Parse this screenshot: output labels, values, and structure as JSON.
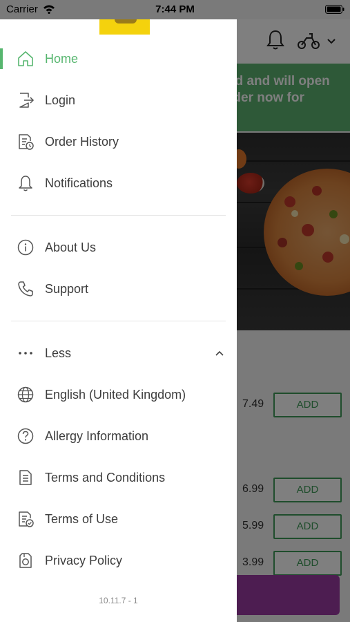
{
  "status_bar": {
    "carrier": "Carrier",
    "time": "7:44 PM"
  },
  "background": {
    "banner_lines": [
      "ed and will open",
      "rder now for"
    ],
    "items": [
      {
        "price": "7.49",
        "add_label": "ADD"
      },
      {
        "price": "6.99",
        "add_label": "ADD"
      },
      {
        "price": "5.99",
        "add_label": "ADD"
      },
      {
        "price": "3.99",
        "add_label": "ADD"
      }
    ]
  },
  "drawer": {
    "menu_primary": [
      {
        "label": "Home",
        "icon": "home-icon",
        "active": true
      },
      {
        "label": "Login",
        "icon": "login-icon",
        "active": false
      },
      {
        "label": "Order History",
        "icon": "order-history-icon",
        "active": false
      },
      {
        "label": "Notifications",
        "icon": "bell-icon",
        "active": false
      }
    ],
    "menu_secondary": [
      {
        "label": "About Us",
        "icon": "info-icon"
      },
      {
        "label": "Support",
        "icon": "phone-icon"
      }
    ],
    "less_toggle": {
      "label": "Less",
      "icon": "more-dots-icon"
    },
    "menu_extra": [
      {
        "label": "English (United Kingdom)",
        "icon": "globe-icon"
      },
      {
        "label": "Allergy Information",
        "icon": "question-icon"
      },
      {
        "label": "Terms and Conditions",
        "icon": "document-icon"
      },
      {
        "label": "Terms of Use",
        "icon": "document-check-icon"
      },
      {
        "label": "Privacy Policy",
        "icon": "privacy-icon"
      }
    ],
    "version": "10.11.7 - 1"
  },
  "colors": {
    "accent": "#57b66f",
    "banner": "#5cb270",
    "cart": "#9b3aa3",
    "logo": "#f4d20d"
  }
}
